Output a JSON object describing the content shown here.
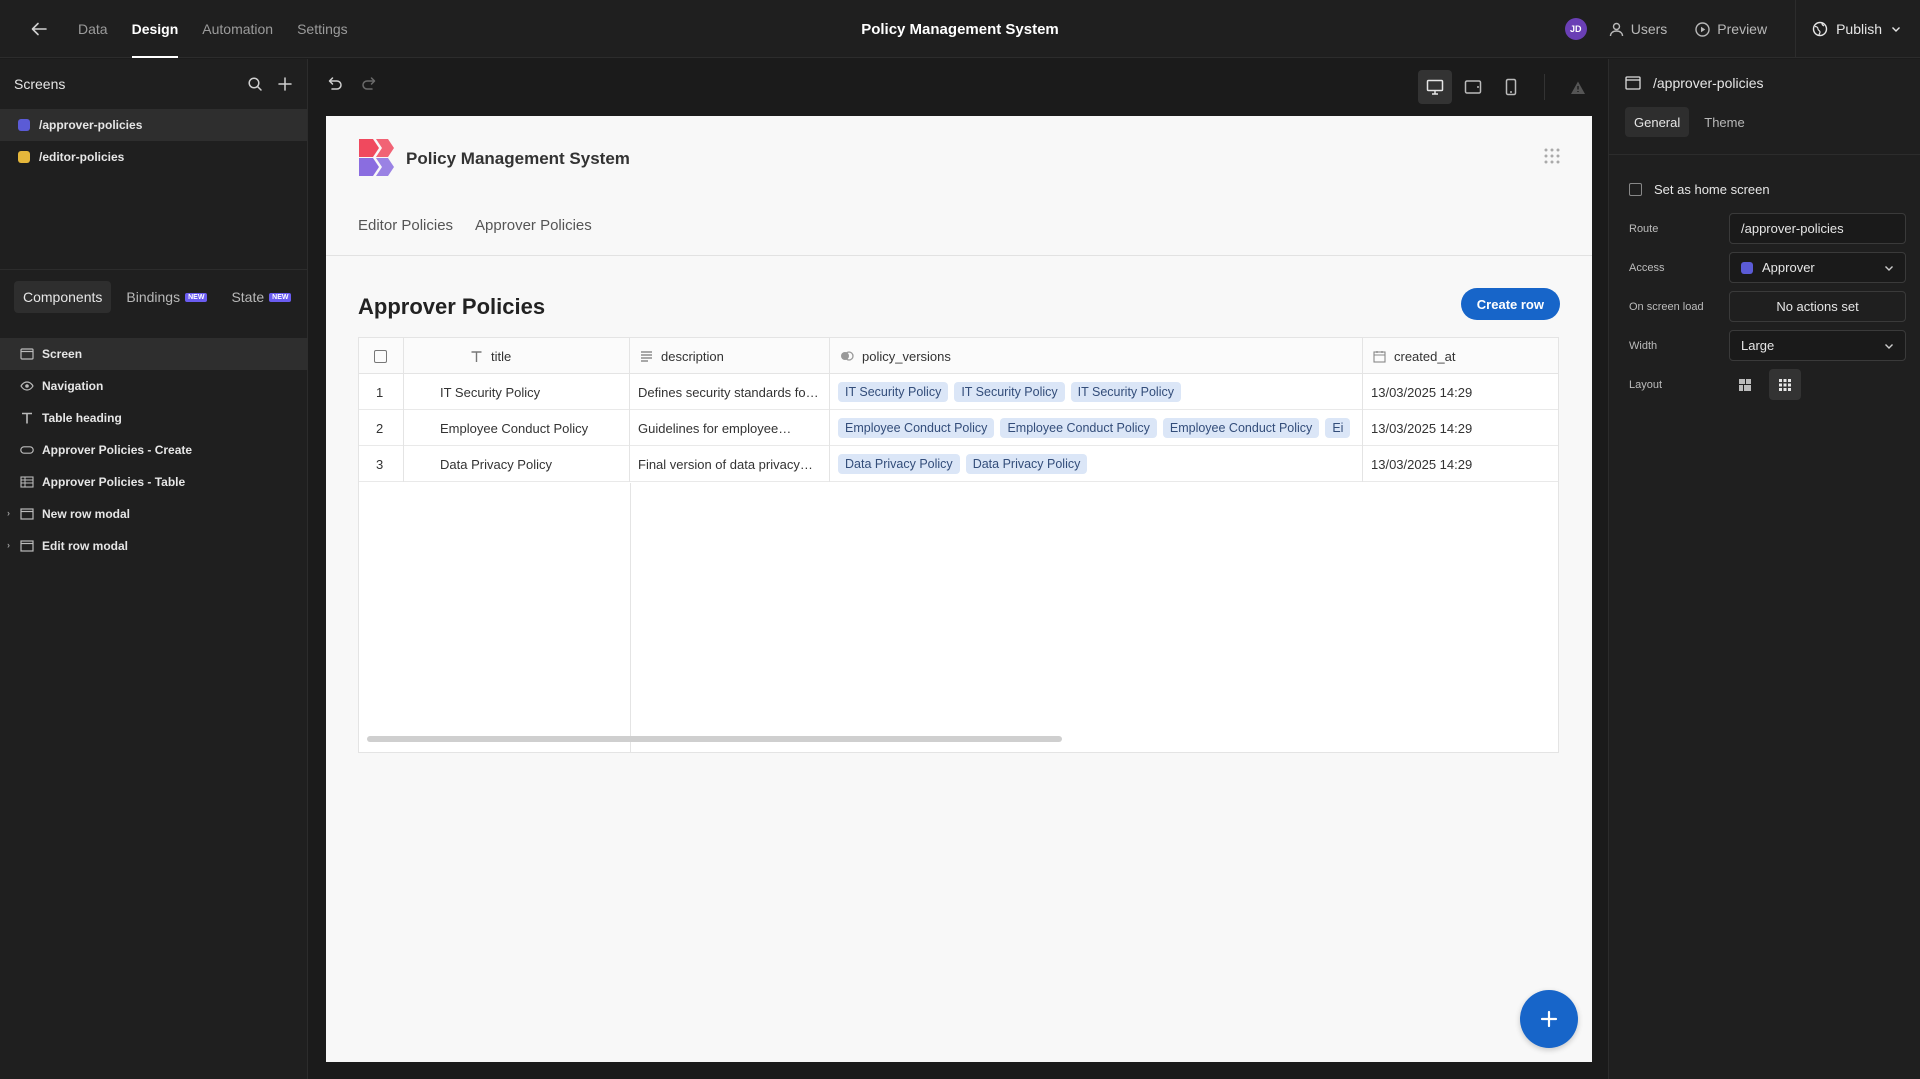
{
  "topbar": {
    "tabs": [
      "Data",
      "Design",
      "Automation",
      "Settings"
    ],
    "active_tab": "Design",
    "title": "Policy Management System",
    "avatar_initials": "JD",
    "users_label": "Users",
    "preview_label": "Preview",
    "publish_label": "Publish"
  },
  "screens": {
    "heading": "Screens",
    "items": [
      {
        "route": "/approver-policies",
        "color": "#5b5bd6"
      },
      {
        "route": "/editor-policies",
        "color": "#e5b73b"
      }
    ]
  },
  "component_tabs": {
    "components": "Components",
    "bindings": "Bindings",
    "state": "State",
    "new_badge": "NEW"
  },
  "tree": [
    {
      "label": "Screen",
      "icon": "screen-icon"
    },
    {
      "label": "Navigation",
      "icon": "eye-icon"
    },
    {
      "label": "Table heading",
      "icon": "text-icon"
    },
    {
      "label": "Approver Policies - Create",
      "icon": "button-icon"
    },
    {
      "label": "Approver Policies - Table",
      "icon": "table-icon"
    },
    {
      "label": "New row modal",
      "icon": "modal-icon"
    },
    {
      "label": "Edit row modal",
      "icon": "modal-icon"
    }
  ],
  "preview": {
    "app_title": "Policy Management System",
    "nav": [
      "Editor Policies",
      "Approver Policies"
    ],
    "heading": "Approver Policies",
    "create_button": "Create row",
    "columns": [
      "title",
      "description",
      "policy_versions",
      "created_at"
    ],
    "rows": [
      {
        "num": "1",
        "title": "IT Security Policy",
        "description": "Defines security standards fo…",
        "tags": [
          "IT Security Policy",
          "IT Security Policy",
          "IT Security Policy"
        ],
        "created_at": "13/03/2025 14:29"
      },
      {
        "num": "2",
        "title": "Employee Conduct Policy",
        "description": "Guidelines for employee…",
        "tags": [
          "Employee Conduct Policy",
          "Employee Conduct Policy",
          "Employee Conduct Policy",
          "Ei"
        ],
        "created_at": "13/03/2025 14:29"
      },
      {
        "num": "3",
        "title": "Data Privacy Policy",
        "description": "Final version of data privacy…",
        "tags": [
          "Data Privacy Policy",
          "Data Privacy Policy"
        ],
        "created_at": "13/03/2025 14:29"
      }
    ]
  },
  "settings": {
    "route_title": "/approver-policies",
    "tabs": [
      "General",
      "Theme"
    ],
    "home_checkbox": "Set as home screen",
    "route_label": "Route",
    "route_value": "/approver-policies",
    "access_label": "Access",
    "access_value": "Approver",
    "access_color": "#5b5bd6",
    "onload_label": "On screen load",
    "onload_value": "No actions set",
    "width_label": "Width",
    "width_value": "Large",
    "layout_label": "Layout"
  },
  "colors": {
    "accent": "#1765c9",
    "logo_red": "#f0495e",
    "logo_purple": "#8a6de0"
  }
}
